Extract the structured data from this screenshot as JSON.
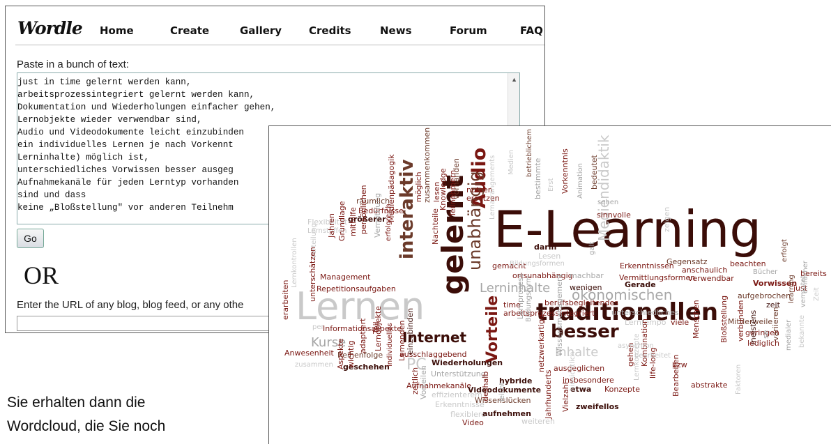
{
  "wordle": {
    "logo": "Wordle",
    "nav": [
      "Home",
      "Create",
      "Gallery",
      "Credits",
      "News",
      "Forum",
      "FAQ"
    ],
    "paste_label": "Paste in a bunch of text:",
    "text_lines": [
      "just in time gelernt werden kann,",
      "arbeitsprozessintegriert gelernt werden kann,",
      "Dokumentation und Wiederholungen einfacher gehen,",
      "Lernobjekte wieder verwendbar sind,",
      "Audio und Videodokumente leicht einzubinden",
      "ein individuelles Lernen je nach Vorkennt",
      "Lerninhalte) möglich ist,",
      "unterschiedliches Vorwissen besser ausgeg",
      "Aufnahmekanäle für jeden Lerntyp vorhanden",
      "sind und dass",
      "keine „Bloßstellung\" vor anderen Teilnehm"
    ],
    "go_label": "Go",
    "or_label": "OR",
    "url_label": "Enter the URL of any blog, blog feed, or any othe"
  },
  "caption": {
    "line1": "Sie erhalten dann die",
    "line2": "Wordcloud, die Sie noch"
  },
  "colors": {
    "dark": "#3b0d08",
    "red": "#7a1712",
    "brown": "#6b3a2a",
    "gray": "#a6a6a6",
    "light": "#c9c9c9"
  },
  "cloud": {
    "words": [
      {
        "text": "E-Learning",
        "c": "dark"
      },
      {
        "text": "Lernen",
        "c": "light"
      },
      {
        "text": "traditionellen",
        "c": "dark"
      },
      {
        "text": "gelernt",
        "c": "dark"
      },
      {
        "text": "Audio",
        "c": "red"
      },
      {
        "text": "unabhängig",
        "c": "brown"
      },
      {
        "text": "interaktiv",
        "c": "brown"
      },
      {
        "text": "Vorteile",
        "c": "red"
      },
      {
        "text": "Internet",
        "c": "dark"
      },
      {
        "text": "besser",
        "c": "dark"
      },
      {
        "text": "Kurse",
        "c": "gray"
      },
      {
        "text": "Inhalte",
        "c": "light"
      },
      {
        "text": "ökonomischen",
        "c": "gray"
      },
      {
        "text": "Mediendidaktik",
        "c": "light"
      },
      {
        "text": "Lerninhalte",
        "c": "gray"
      },
      {
        "text": "PC",
        "c": "light"
      },
      {
        "text": "räumlich",
        "c": "brown"
      },
      {
        "text": "Bedürfnisse",
        "c": "red"
      },
      {
        "text": "möglich",
        "c": "red"
      },
      {
        "text": "lesen",
        "c": "red"
      },
      {
        "text": "vorhanden",
        "c": "brown"
      },
      {
        "text": "nutzen",
        "c": "red"
      },
      {
        "text": "ersetzen",
        "c": "red"
      },
      {
        "text": "Medien",
        "c": "light"
      },
      {
        "text": "betrieblichem",
        "c": "brown"
      },
      {
        "text": "Erst",
        "c": "light"
      },
      {
        "text": "bestimmte",
        "c": "gray"
      },
      {
        "text": "Vorkenntnis",
        "c": "red"
      },
      {
        "text": "Animation",
        "c": "gray"
      },
      {
        "text": "bedeutet",
        "c": "brown"
      },
      {
        "text": "sehen",
        "c": "gray"
      },
      {
        "text": "sinnvolle",
        "c": "red"
      },
      {
        "text": "Flexibilität",
        "c": "light"
      },
      {
        "text": "größerer",
        "c": "dark"
      },
      {
        "text": "Lernstoffen",
        "c": "light"
      },
      {
        "text": "Medienpädagogik",
        "c": "red"
      },
      {
        "text": "zusammenkommen",
        "c": "brown"
      },
      {
        "text": "Knowledge",
        "c": "red"
      },
      {
        "text": "Nachteile",
        "c": "red"
      },
      {
        "text": "Teilnehmern",
        "c": "red"
      },
      {
        "text": "Lernarrangements",
        "c": "light"
      },
      {
        "text": "darin",
        "c": "dark"
      },
      {
        "text": "Lesen",
        "c": "light"
      },
      {
        "text": "gemacht",
        "c": "red"
      },
      {
        "text": "Bildungsformen",
        "c": "light"
      },
      {
        "text": "ortsunabhängig",
        "c": "red"
      },
      {
        "text": "machbar",
        "c": "gray"
      },
      {
        "text": "galt",
        "c": "gray"
      },
      {
        "text": "wenigen",
        "c": "dark"
      },
      {
        "text": "zeigen",
        "c": "light"
      },
      {
        "text": "Erkenntnissen",
        "c": "red"
      },
      {
        "text": "Gegensatz",
        "c": "brown"
      },
      {
        "text": "beachten",
        "c": "red"
      },
      {
        "text": "anschaulich",
        "c": "red"
      },
      {
        "text": "Bücher",
        "c": "gray"
      },
      {
        "text": "erfolgt",
        "c": "brown"
      },
      {
        "text": "Vermittlungsformen",
        "c": "red"
      },
      {
        "text": "verwendbar",
        "c": "red"
      },
      {
        "text": "bereits",
        "c": "red"
      },
      {
        "text": "Vorwissen",
        "c": "red"
      },
      {
        "text": "just",
        "c": "red"
      },
      {
        "text": "Gerade",
        "c": "dark"
      },
      {
        "text": "Jahren",
        "c": "red"
      },
      {
        "text": "Grundlage",
        "c": "red"
      },
      {
        "text": "mithilfe",
        "c": "red"
      },
      {
        "text": "persönlichen",
        "c": "red"
      },
      {
        "text": "Vermittlung",
        "c": "gray"
      },
      {
        "text": "erfolgreich",
        "c": "red"
      },
      {
        "text": "Management",
        "c": "red"
      },
      {
        "text": "Repetitionsaufgaben",
        "c": "red"
      },
      {
        "text": "Verteilung",
        "c": "light"
      },
      {
        "text": "unterschätzen",
        "c": "red"
      },
      {
        "text": "time",
        "c": "red"
      },
      {
        "text": "berufsbegleitendes",
        "c": "red"
      },
      {
        "text": "arbeitsprozessintegriert",
        "c": "red"
      },
      {
        "text": "aufgebrochen",
        "c": "brown"
      },
      {
        "text": "zeit",
        "c": "dark"
      },
      {
        "text": "Zeit",
        "c": "light"
      },
      {
        "text": "einfacher",
        "c": "gray"
      },
      {
        "text": "learning",
        "c": "brown"
      },
      {
        "text": "Lernkontrollen",
        "c": "light"
      },
      {
        "text": "erarbeiten",
        "c": "red"
      },
      {
        "text": "per",
        "c": "light"
      },
      {
        "text": "Informationsaspekte",
        "c": "red"
      },
      {
        "text": "Teil",
        "c": "red"
      },
      {
        "text": "Reihenfolge",
        "c": "brown"
      },
      {
        "text": "Anwesenheit",
        "c": "red"
      },
      {
        "text": "ausschlaggebend",
        "c": "red"
      },
      {
        "text": "Lernprozess",
        "c": "gray"
      },
      {
        "text": "Bildungsform",
        "c": "gray"
      },
      {
        "text": "unterschiedliches",
        "c": "gray"
      },
      {
        "text": "Lerntempo",
        "c": "light"
      },
      {
        "text": "viele",
        "c": "red"
      },
      {
        "text": "Mittlerweile",
        "c": "brown"
      },
      {
        "text": "geringen",
        "c": "red"
      },
      {
        "text": "lediglich",
        "c": "red"
      },
      {
        "text": "vermutet",
        "c": "gray"
      },
      {
        "text": "zusammen",
        "c": "light"
      },
      {
        "text": "geschehen",
        "c": "dark"
      },
      {
        "text": "Wiederholungen",
        "c": "dark"
      },
      {
        "text": "Unterstützung",
        "c": "gray"
      },
      {
        "text": "ausgeglichen",
        "c": "red"
      },
      {
        "text": "insbesondere",
        "c": "red"
      },
      {
        "text": "etwa",
        "c": "dark"
      },
      {
        "text": "Konzepte",
        "c": "red"
      },
      {
        "text": "abstrakte",
        "c": "red"
      },
      {
        "text": "Aspekte",
        "c": "red"
      },
      {
        "text": "wichtig",
        "c": "red"
      },
      {
        "text": "adaptiert",
        "c": "red"
      },
      {
        "text": "Lernobjekte",
        "c": "red"
      },
      {
        "text": "individuelles",
        "c": "red"
      },
      {
        "text": "Lernenden",
        "c": "red"
      },
      {
        "text": "einzubinden",
        "c": "dark"
      },
      {
        "text": "Aufnahmekanäle",
        "c": "red"
      },
      {
        "text": "effizienterem",
        "c": "light"
      },
      {
        "text": "Erkenntnisse",
        "c": "light"
      },
      {
        "text": "flexiblere",
        "c": "light"
      },
      {
        "text": "Videodokumente",
        "c": "dark"
      },
      {
        "text": "hybride",
        "c": "dark"
      },
      {
        "text": "Wissenslücken",
        "c": "brown"
      },
      {
        "text": "aufnehmen",
        "c": "dark"
      },
      {
        "text": "weiteren",
        "c": "light"
      },
      {
        "text": "Video",
        "c": "red"
      },
      {
        "text": "zeitlich",
        "c": "red"
      },
      {
        "text": "Vorteilen",
        "c": "gray"
      },
      {
        "text": "deshalb",
        "c": "red"
      },
      {
        "text": "leicht",
        "c": "gray"
      },
      {
        "text": "netzwerkartige",
        "c": "red"
      },
      {
        "text": "Wissensmanagement",
        "c": "gray"
      },
      {
        "text": "Jahrhunderts",
        "c": "red"
      },
      {
        "text": "Vielzahl",
        "c": "red"
      },
      {
        "text": "hinsichtlich",
        "c": "light"
      },
      {
        "text": "zweifellos",
        "c": "dark"
      },
      {
        "text": "gehen",
        "c": "red"
      },
      {
        "text": "Kombination",
        "c": "red"
      },
      {
        "text": "life-long",
        "c": "red"
      },
      {
        "text": "Bearbeiten",
        "c": "red"
      },
      {
        "text": "asynchron",
        "c": "light"
      },
      {
        "text": "bearbeitet",
        "c": "light"
      },
      {
        "text": "bzw",
        "c": "red"
      },
      {
        "text": "Lernkonzepte",
        "c": "light"
      },
      {
        "text": "Menschen",
        "c": "red"
      },
      {
        "text": "Bloßstellung",
        "c": "red"
      },
      {
        "text": "Faktoren",
        "c": "light"
      },
      {
        "text": "verbunden",
        "c": "red"
      },
      {
        "text": "meistens",
        "c": "dark"
      },
      {
        "text": "se",
        "c": "gray"
      },
      {
        "text": "variieren",
        "c": "brown"
      },
      {
        "text": "medialer",
        "c": "gray"
      },
      {
        "text": "bekannte",
        "c": "light"
      }
    ]
  }
}
